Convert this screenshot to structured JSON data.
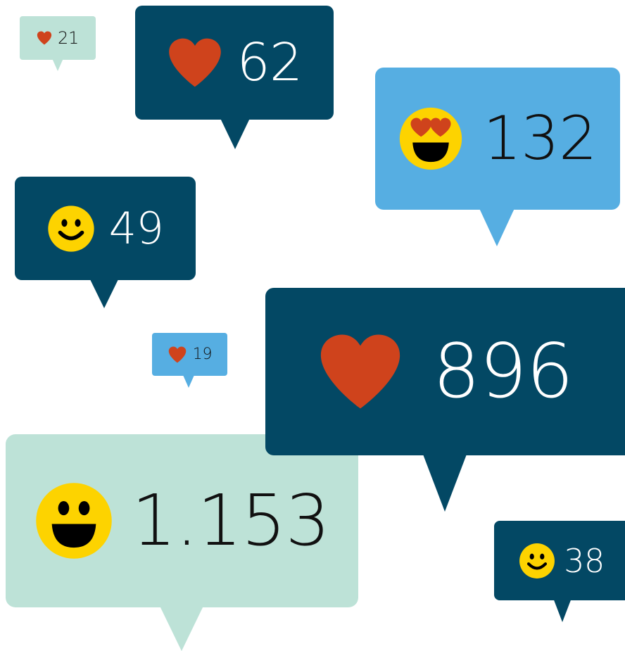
{
  "colors": {
    "navy": "#034864",
    "sky": "#56aee2",
    "mint": "#bde2d7",
    "heart": "#cf431c",
    "smiley": "#fdd300",
    "white_text": "#ffffff",
    "dark_text": "#111111"
  },
  "bubbles": [
    {
      "icon": "heart-icon",
      "count": "21",
      "color": "mint"
    },
    {
      "icon": "heart-icon",
      "count": "62",
      "color": "navy"
    },
    {
      "icon": "heart-eyes-smiley-icon",
      "count": "132",
      "color": "sky"
    },
    {
      "icon": "smiley-icon",
      "count": "49",
      "color": "navy"
    },
    {
      "icon": "heart-icon",
      "count": "19",
      "color": "sky"
    },
    {
      "icon": "heart-icon",
      "count": "896",
      "color": "navy"
    },
    {
      "icon": "grin-smiley-icon",
      "count": "1.153",
      "color": "mint"
    },
    {
      "icon": "smiley-icon",
      "count": "38",
      "color": "navy"
    }
  ]
}
